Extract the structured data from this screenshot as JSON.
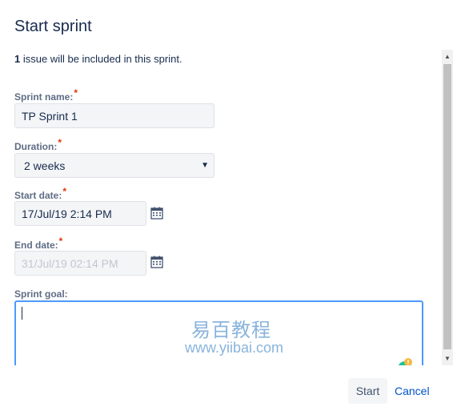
{
  "dialog": {
    "title": "Start sprint",
    "issue_count": "1",
    "issue_text": " issue will be included in this sprint."
  },
  "form": {
    "required_mark": "*",
    "sprint_name": {
      "label": "Sprint name:",
      "value": "TP Sprint 1"
    },
    "duration": {
      "label": "Duration:",
      "value": "2 weeks",
      "icon": "chevron-down-icon"
    },
    "start_date": {
      "label": "Start date:",
      "value": "17/Jul/19 2:14 PM",
      "icon": "calendar-icon"
    },
    "end_date": {
      "label": "End date:",
      "value": "31/Jul/19 02:14 PM",
      "icon": "calendar-icon",
      "disabled": true
    },
    "sprint_goal": {
      "label": "Sprint goal:",
      "value": ""
    }
  },
  "watermark": {
    "line1": "易百教程",
    "line2": "www.yiibai.com"
  },
  "buttons": {
    "start": "Start",
    "cancel": "Cancel"
  },
  "colors": {
    "accent": "#4c9aff",
    "link": "#0052cc",
    "required": "#de350b",
    "field_bg": "#f4f5f7"
  }
}
